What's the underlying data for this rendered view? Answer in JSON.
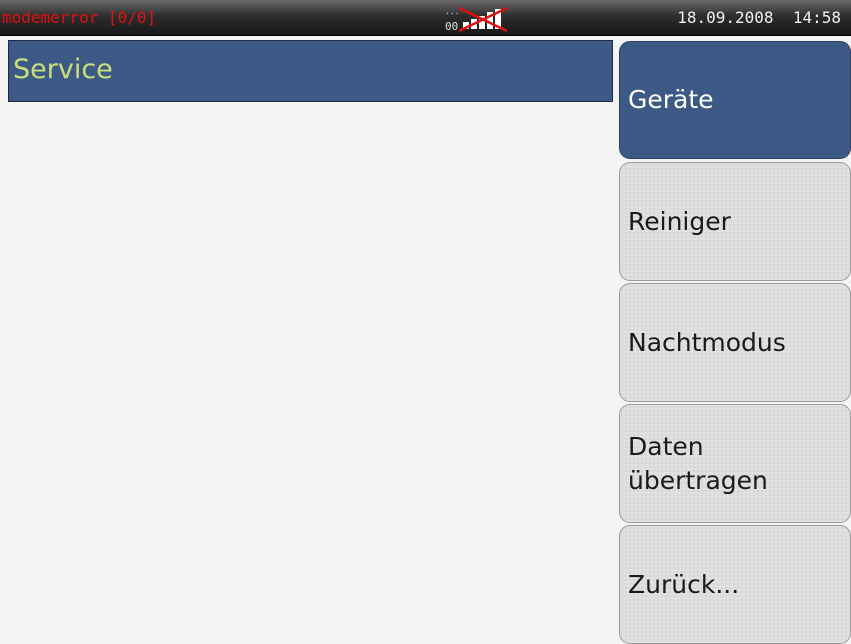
{
  "statusbar": {
    "error_text": "modemerror [0/0]",
    "signal_counter": "00",
    "signal_icon": "signal-strength-crossed-icon",
    "datetime": "18.09.2008  14:58"
  },
  "main": {
    "title": "Service"
  },
  "menu": {
    "items": [
      {
        "label": "Geräte",
        "active": true
      },
      {
        "label": "Reiniger",
        "active": false
      },
      {
        "label": "Nachtmodus",
        "active": false
      },
      {
        "label": "Daten\nübertragen",
        "active": false
      },
      {
        "label": "Zurück...",
        "active": false
      }
    ]
  },
  "colors": {
    "accent_blue": "#3d5a86",
    "title_text": "#c9e07a",
    "error_red": "#e01010"
  }
}
